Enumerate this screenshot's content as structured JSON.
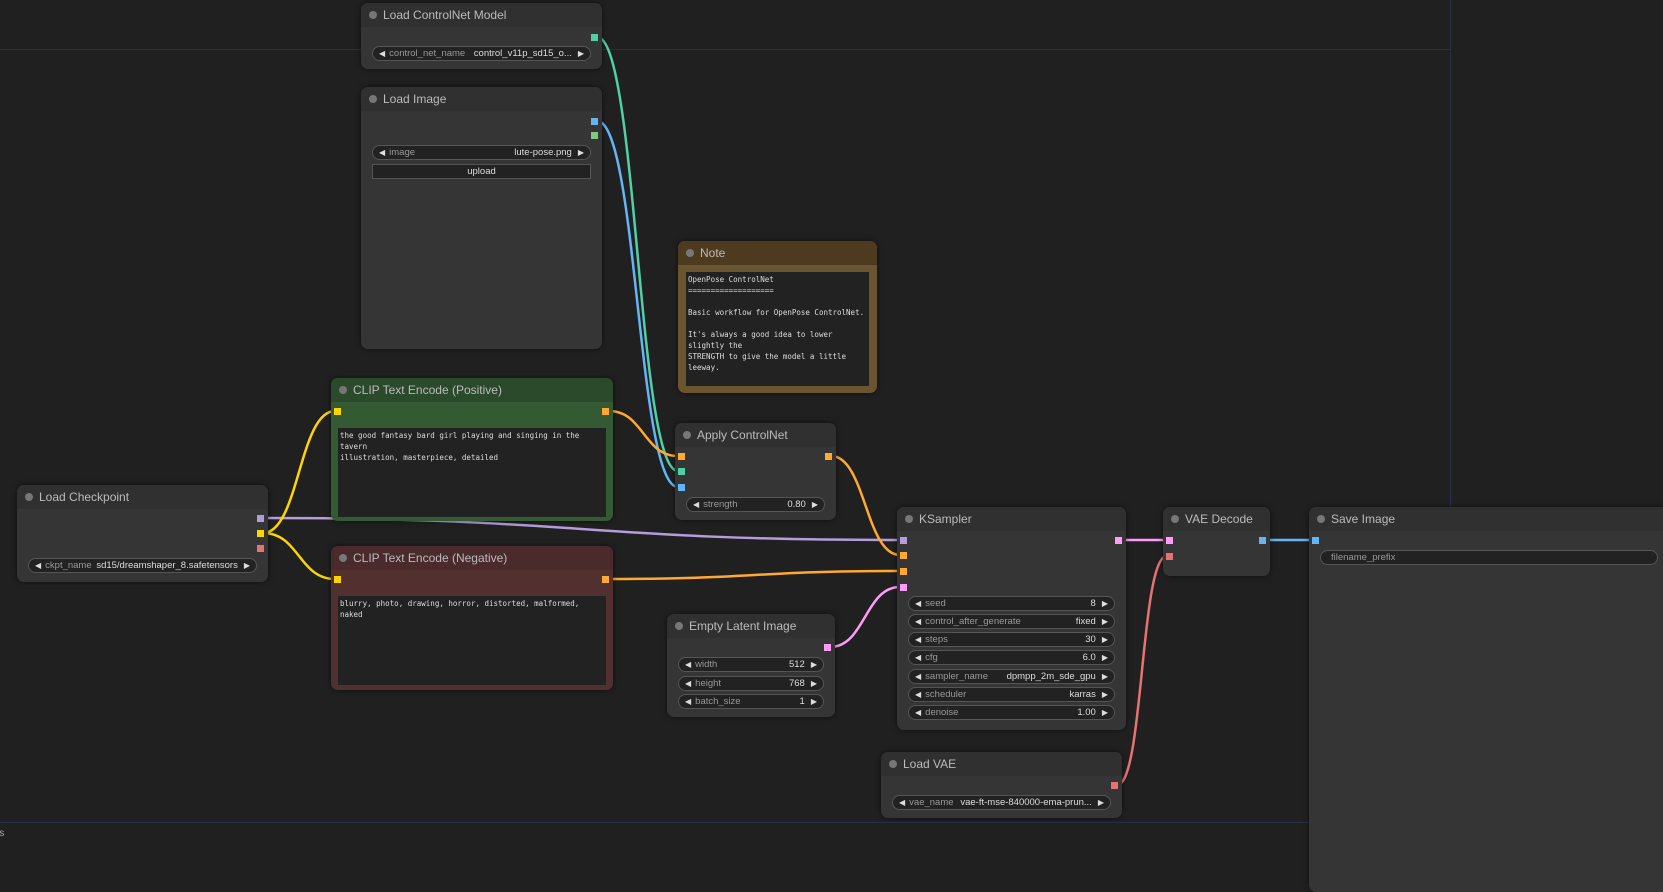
{
  "colors": {
    "model": "#b39ddb",
    "clip": "#ffd500",
    "vae": "#e57373",
    "conditioning": "#ffa931",
    "control_net": "#4fd1a5",
    "image": "#64b5f6",
    "mask": "#81c784",
    "latent": "#ff9cf9"
  },
  "nodes": {
    "cn": {
      "title": "Load ControlNet Model",
      "widgets": [
        {
          "label": "control_net_name",
          "value": "control_v11p_sd15_o..."
        }
      ]
    },
    "img": {
      "title": "Load Image",
      "widgets": [
        {
          "label": "image",
          "value": "lute-pose.png"
        }
      ],
      "button": "upload"
    },
    "note": {
      "title": "Note",
      "text": "OpenPose ControlNet\n===================\n\nBasic workflow for OpenPose ControlNet.\n\nIt's always a good idea to lower slightly the\nSTRENGTH to give the model a little leeway."
    },
    "pos": {
      "title": "CLIP Text Encode (Positive)",
      "text": "the good fantasy bard girl playing and singing in the tavern\nillustration, masterpiece, detailed"
    },
    "neg": {
      "title": "CLIP Text Encode (Negative)",
      "text": "blurry, photo, drawing, horror, distorted, malformed, naked"
    },
    "ckpt": {
      "title": "Load Checkpoint",
      "widgets": [
        {
          "label": "ckpt_name",
          "value": "sd15/dreamshaper_8.safetensors"
        }
      ]
    },
    "apply": {
      "title": "Apply ControlNet",
      "widgets": [
        {
          "label": "strength",
          "value": "0.80"
        }
      ]
    },
    "ks": {
      "title": "KSampler",
      "widgets": [
        {
          "label": "seed",
          "value": "8"
        },
        {
          "label": "control_after_generate",
          "value": "fixed"
        },
        {
          "label": "steps",
          "value": "30"
        },
        {
          "label": "cfg",
          "value": "6.0"
        },
        {
          "label": "sampler_name",
          "value": "dpmpp_2m_sde_gpu"
        },
        {
          "label": "scheduler",
          "value": "karras"
        },
        {
          "label": "denoise",
          "value": "1.00"
        }
      ]
    },
    "latent": {
      "title": "Empty Latent Image",
      "widgets": [
        {
          "label": "width",
          "value": "512"
        },
        {
          "label": "height",
          "value": "768"
        },
        {
          "label": "batch_size",
          "value": "1"
        }
      ]
    },
    "dec": {
      "title": "VAE Decode"
    },
    "save": {
      "title": "Save Image",
      "widgets": [
        {
          "label": "filename_prefix",
          "value": ""
        }
      ]
    },
    "vae": {
      "title": "Load VAE",
      "widgets": [
        {
          "label": "vae_name",
          "value": "vae-ft-mse-840000-ema-prun..."
        }
      ]
    }
  },
  "status_text": "ls"
}
